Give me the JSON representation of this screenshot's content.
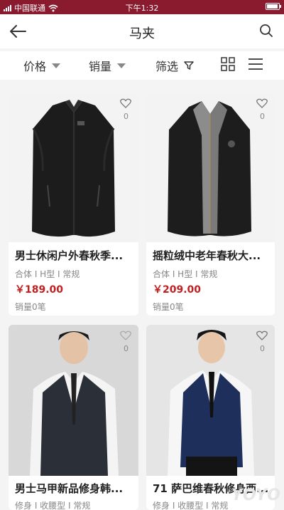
{
  "status": {
    "carrier": "中国联通",
    "time": "下午1:32"
  },
  "header": {
    "title": "马夹"
  },
  "filters": {
    "price": "价格",
    "sales": "销量",
    "filter": "筛选"
  },
  "products": [
    {
      "name": "男士休闲户外春秋季...",
      "tags": "合体 I H型 I 常规",
      "price": "￥189.00",
      "sales": "销量0笔",
      "likes": "0"
    },
    {
      "name": "摇粒绒中老年春秋大...",
      "tags": "合体 I H型 I 常规",
      "price": "￥209.00",
      "sales": "销量0笔",
      "likes": "0"
    },
    {
      "name": "男士马甲新品修身韩...",
      "tags": "修身 I 收腰型 I 常规",
      "price": "",
      "sales": "",
      "likes": "0"
    },
    {
      "name": "71 萨巴维春秋修身西...",
      "tags": "修身 I 收腰型 I 常规",
      "price": "",
      "sales": "",
      "likes": "0"
    }
  ],
  "watermark": "YOYO"
}
